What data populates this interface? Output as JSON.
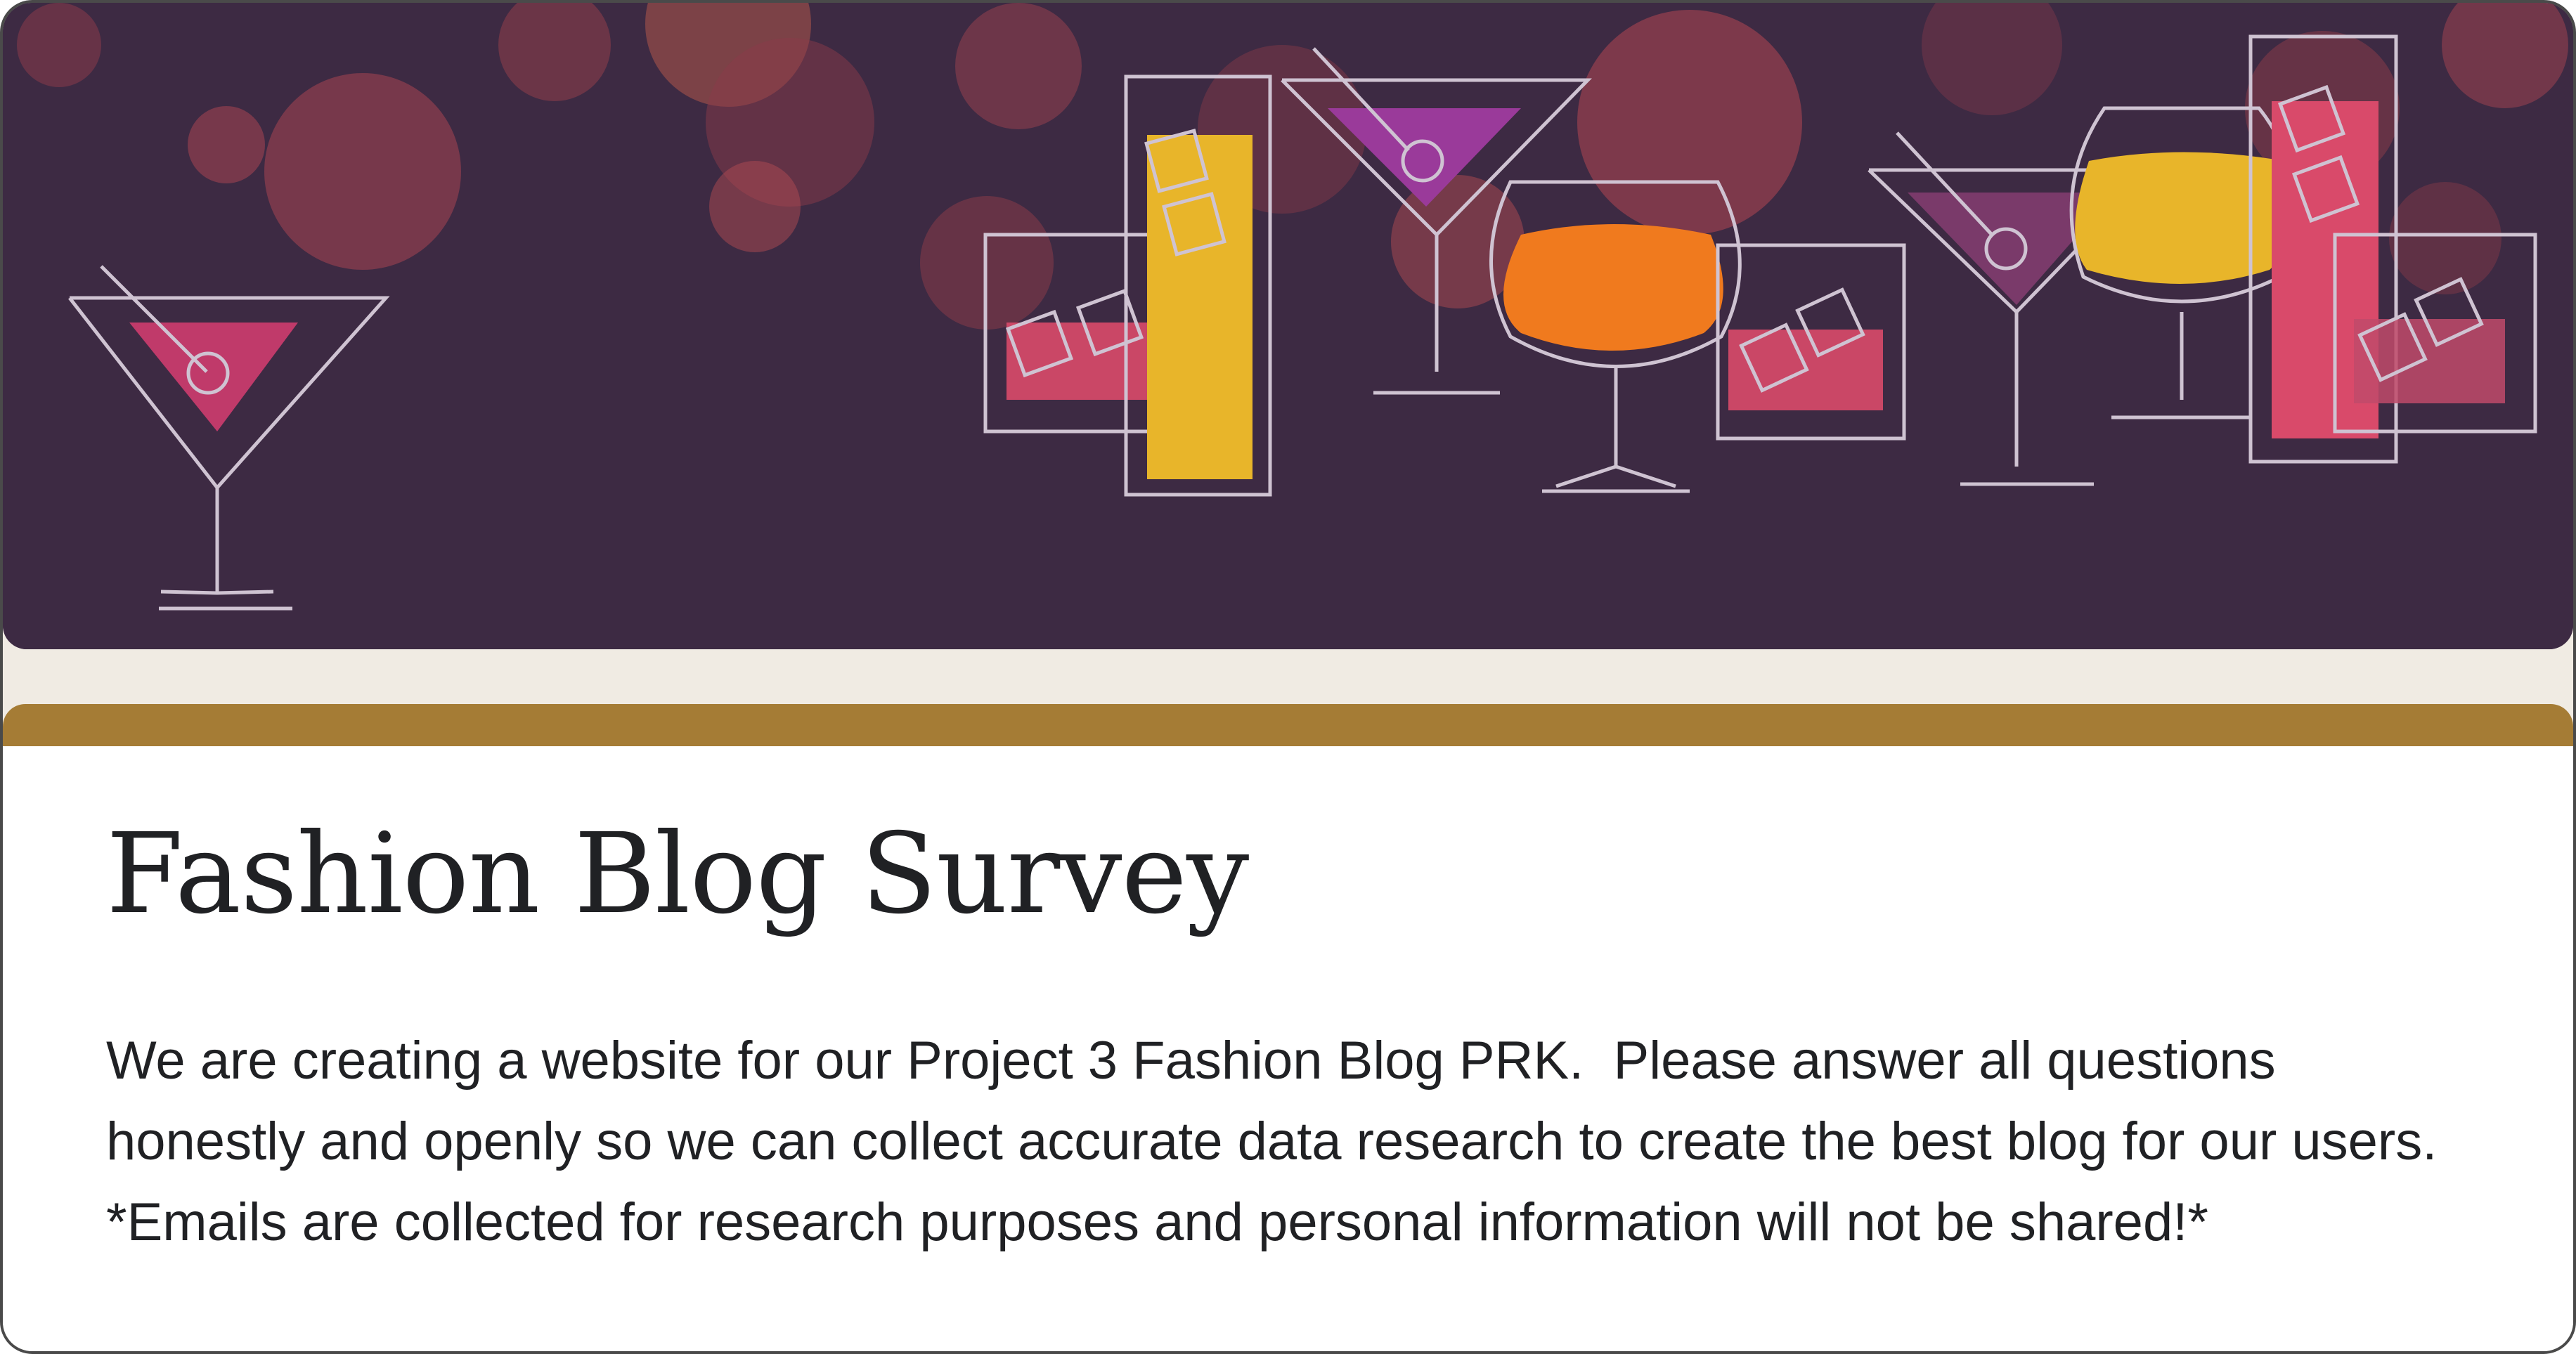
{
  "banner": {
    "theme": "cocktail-party",
    "colors": {
      "background": "#3d2a43",
      "bokeh": "#8a3a4a",
      "glass_outline": "#cfc3d2",
      "gold": "#e8b52a",
      "pink": "#d94a6a",
      "orange": "#f07a1e",
      "purple": "#8a3a8a"
    }
  },
  "form": {
    "accent_color": "#a57c35",
    "title": "Fashion Blog Survey",
    "description": "We are creating a website for our Project 3 Fashion Blog PRK.  Please answer all questions honestly and openly so we can collect accurate data research to create the best blog for our users.  *Emails are collected for research purposes and personal information will not be shared!*"
  }
}
